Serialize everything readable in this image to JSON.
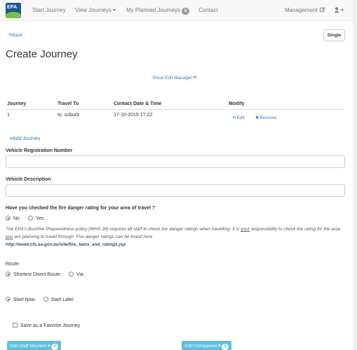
{
  "navbar": {
    "logo_text": "EPA",
    "items": [
      {
        "label": "Start Journey"
      },
      {
        "label": "View Journeys"
      },
      {
        "label": "My Planned Journeys",
        "badge": "0"
      },
      {
        "label": "Contact"
      }
    ],
    "management_label": "Management",
    "user_icon": "user-icon"
  },
  "header": {
    "back_label": "Back",
    "single_label": "Single",
    "title": "Create Journey",
    "edit_manager_label": "Show Edit Manager"
  },
  "journeys_table": {
    "columns": [
      "Journey",
      "Travel To",
      "Contact Date & Time",
      "Modify"
    ],
    "rows": [
      {
        "journey": "1",
        "travel_to": "to, suburb",
        "contact_datetime": "17-10-2015 17:22",
        "edit_label": "Edit",
        "remove_label": "Remove"
      }
    ]
  },
  "add_journey_label": "Add Journey",
  "form": {
    "vehicle_rego_label": "Vehicle Registration Number",
    "vehicle_rego_value": "",
    "vehicle_desc_label": "Vehicle Description",
    "vehicle_desc_value": "",
    "fire_question": "Have you checked the fire danger rating for your area of travel ?",
    "fire_options": [
      {
        "label": "No",
        "checked": true
      },
      {
        "label": "Yes",
        "checked": false
      }
    ],
    "notice": {
      "part1": "The EPA's Bushfire Preparedness policy (WHS 28) requires all staff to check fire danger ratings when travelling. It is ",
      "underlined1": "your",
      "part2": " responsibility to check the rating for the area ",
      "underlined2": "you",
      "part3": " are planning to travel through. Fire danger ratings can be found here",
      "url": "http://www.cfs.sa.gov.au/site/fire_bans_and_ratings.jsp"
    },
    "route_label": "Route:",
    "route_options": [
      {
        "label": "Shortest Direct Route",
        "checked": true
      },
      {
        "label": "Via",
        "checked": false
      }
    ],
    "start_options": [
      {
        "label": "Start Now",
        "checked": true
      },
      {
        "label": "Start Later",
        "checked": false
      }
    ],
    "favorite_label": "Save as a Favorite Journey",
    "favorite_checked": false
  },
  "buttons": {
    "add_staff_label": "Add Staff Member",
    "add_staff_count": "0",
    "add_companion_label": "Add Companion",
    "add_companion_count": "0"
  },
  "colors": {
    "link": "#337ab7",
    "info_button": "#5bc0de",
    "navbar_bg": "#f8f8f8",
    "logo_blue": "#1a5a8f",
    "logo_green": "#7ac143"
  }
}
